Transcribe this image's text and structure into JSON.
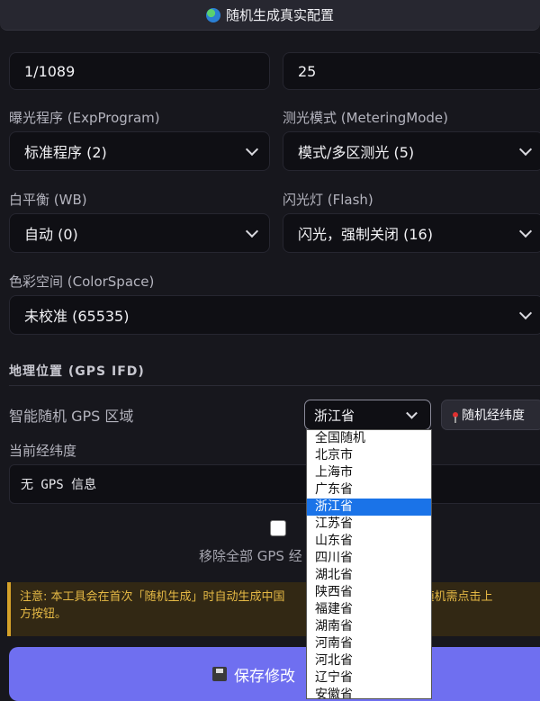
{
  "top_button": {
    "label": "随机生成真实配置",
    "icon": "globe-icon"
  },
  "fields": {
    "exposure_time": {
      "value": "1/1089"
    },
    "focal_or_iso": {
      "value": "25"
    },
    "exp_program": {
      "label": "曝光程序 (ExpProgram)",
      "value": "标准程序 (2)"
    },
    "metering_mode": {
      "label": "测光模式 (MeteringMode)",
      "value": "模式/多区测光 (5)"
    },
    "white_balance": {
      "label": "白平衡 (WB)",
      "value": "自动 (0)"
    },
    "flash": {
      "label": "闪光灯 (Flash)",
      "value": "闪光，强制关闭 (16)"
    },
    "color_space": {
      "label": "色彩空间 (ColorSpace)",
      "value": "未校准 (65535)"
    }
  },
  "gps": {
    "section_title": "地理位置 (GPS IFD)",
    "region_label": "智能随机 GPS 区域",
    "region_value": "浙江省",
    "random_button": "随机经纬度",
    "coord_label": "当前经纬度",
    "coord_value": "无 GPS 信息",
    "remove_label": "移除全部 GPS 经",
    "remove_checked": false,
    "options": [
      "全国随机",
      "北京市",
      "上海市",
      "广东省",
      "浙江省",
      "江苏省",
      "山东省",
      "四川省",
      "湖北省",
      "陕西省",
      "福建省",
      "湖南省",
      "河南省",
      "河北省",
      "辽宁省",
      "安徽省"
    ],
    "selected_index": 4
  },
  "notice": {
    "line1": "注意: 本工具会在首次「随机生成」时自动生成中国",
    "line1_tail": "次随机需点击上",
    "line2": "方按钮。"
  },
  "save_button": {
    "label": "保存修改",
    "icon": "floppy-icon"
  },
  "colors": {
    "accent": "#6f6ff0",
    "warning": "#e5b945",
    "selection": "#1a73e8"
  }
}
